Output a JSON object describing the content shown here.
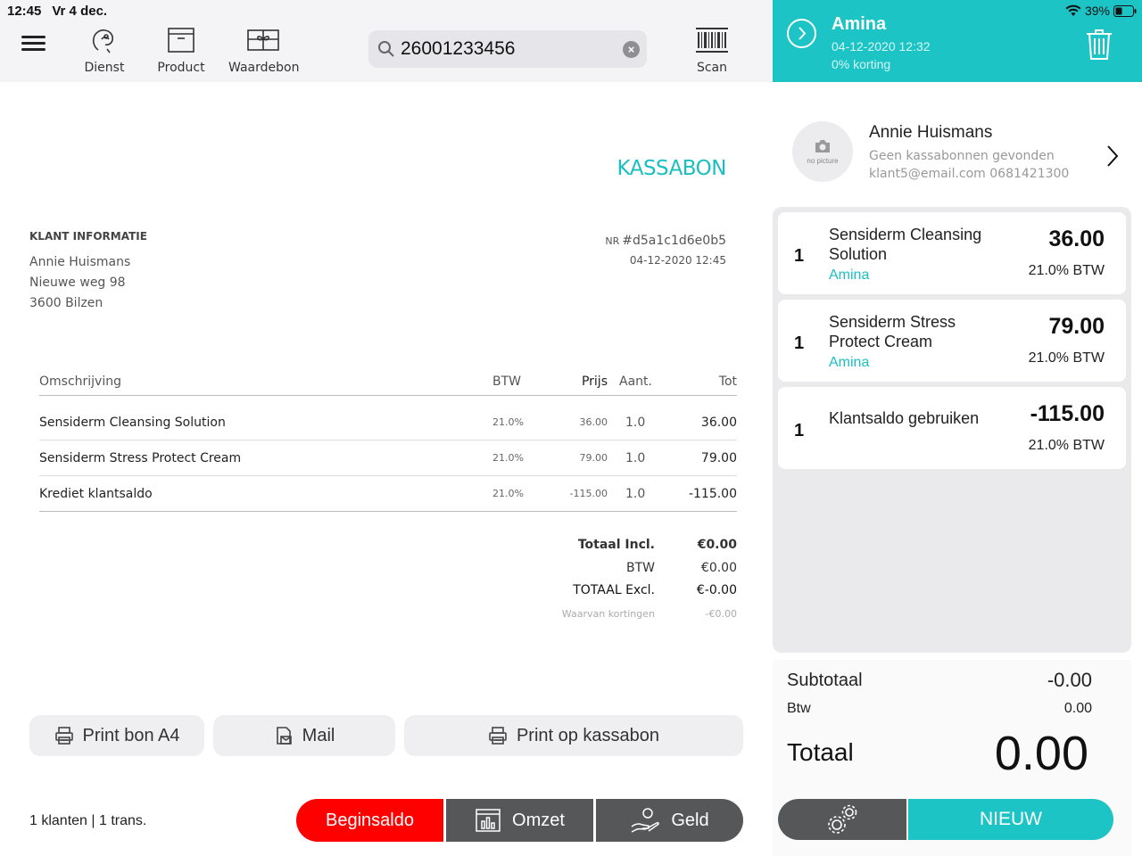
{
  "statusbar": {
    "time": "12:45",
    "date": "Vr 4 dec.",
    "battery": "39%"
  },
  "toolbar": {
    "service_label": "Dienst",
    "product_label": "Product",
    "voucher_label": "Waardebon",
    "scan_label": "Scan",
    "search_value": "26001233456"
  },
  "receipt": {
    "title": "KASSABON",
    "client_info_heading": "KLANT INFORMATIE",
    "client_name": "Annie Huismans",
    "client_street": "Nieuwe weg 98",
    "client_city": "3600 Bilzen",
    "nr_label": "NR",
    "nr_value": "#d5a1c1d6e0b5",
    "date": "04-12-2020 12:45",
    "columns": {
      "desc": "Omschrijving",
      "vat": "BTW",
      "price": "Prijs",
      "qty": "Aant.",
      "total": "Tot"
    },
    "rows": [
      {
        "desc": "Sensiderm Cleansing Solution",
        "vat": "21.0%",
        "price": "36.00",
        "qty": "1.0",
        "total": "36.00"
      },
      {
        "desc": "Sensiderm Stress Protect Cream",
        "vat": "21.0%",
        "price": "79.00",
        "qty": "1.0",
        "total": "79.00"
      },
      {
        "desc": "Krediet klantsaldo",
        "vat": "21.0%",
        "price": "-115.00",
        "qty": "1.0",
        "total": "-115.00"
      }
    ],
    "totals": {
      "incl_label": "Totaal Incl.",
      "incl_value": "€0.00",
      "vat_label": "BTW",
      "vat_value": "€0.00",
      "excl_label": "TOTAAL Excl.",
      "excl_value": "€-0.00",
      "disc_label": "Waarvan kortingen",
      "disc_value": "-€0.00"
    }
  },
  "actions": {
    "print_a4": "Print bon A4",
    "mail": "Mail",
    "print_receipt": "Print op kassabon"
  },
  "footer": {
    "stats": "1 klanten | 1 trans.",
    "start_balance": "Beginsaldo",
    "revenue": "Omzet",
    "money": "Geld"
  },
  "session": {
    "employee": "Amina",
    "datetime": "04-12-2020 12:32",
    "discount": "0% korting"
  },
  "customer": {
    "name": "Annie Huismans",
    "no_receipts": "Geen kassabonnen gevonden",
    "contact": "klant5@email.com 0681421300",
    "avatar_text": "no picture"
  },
  "cart": {
    "items": [
      {
        "qty": "1",
        "name": "Sensiderm Cleansing Solution",
        "employee": "Amina",
        "price": "36.00",
        "vat": "21.0% BTW"
      },
      {
        "qty": "1",
        "name": "Sensiderm Stress Protect Cream",
        "employee": "Amina",
        "price": "79.00",
        "vat": "21.0% BTW"
      },
      {
        "qty": "1",
        "name": "Klantsaldo gebruiken",
        "employee": "",
        "price": "-115.00",
        "vat": "21.0% BTW"
      }
    ]
  },
  "summary": {
    "subtotal_label": "Subtotaal",
    "subtotal_value": "-0.00",
    "vat_label": "Btw",
    "vat_value": "0.00",
    "total_label": "Totaal",
    "total_value": "0.00"
  },
  "buttons": {
    "new": "NIEUW"
  },
  "colors": {
    "accent": "#1cc4c5",
    "danger": "#ff0000",
    "dark_button": "#555759"
  }
}
